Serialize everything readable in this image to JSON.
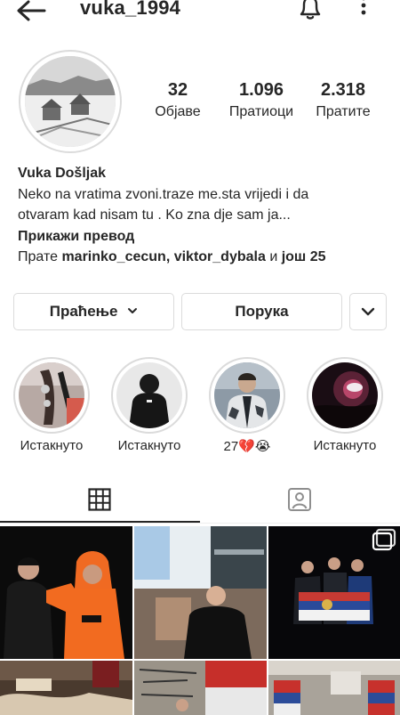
{
  "header": {
    "username": "vuka_1994"
  },
  "stats": [
    {
      "value": "32",
      "label": "Објаве"
    },
    {
      "value": "1.096",
      "label": "Пратиоци"
    },
    {
      "value": "2.318",
      "label": "Пратите"
    }
  ],
  "bio": {
    "name": "Vuka Došljak",
    "text_line1": "Neko na vratima zvoni.traze me.sta vrijedi i da",
    "text_line2": "otvaram kad nisam tu . Ko zna dje sam ja...",
    "translate": "Прикажи превод",
    "followed_prefix": "Прате ",
    "followed_names": "marinko_cecun, viktor_dybala",
    "followed_and": " и ",
    "followed_more": "још 25"
  },
  "actions": {
    "following_label": "Праћење",
    "message_label": "Порука"
  },
  "highlights": [
    {
      "caption": "Истакнуто"
    },
    {
      "caption": "Истакнуто"
    },
    {
      "caption": "27💔😭"
    },
    {
      "caption": "Истакнуто"
    }
  ],
  "icons": {
    "back": "arrow-left-icon",
    "bell": "bell-icon",
    "more": "more-vertical-icon",
    "chevron": "chevron-down-icon",
    "grid": "grid-icon",
    "tagged": "tagged-icon",
    "multi": "multiple-photos-icon"
  }
}
